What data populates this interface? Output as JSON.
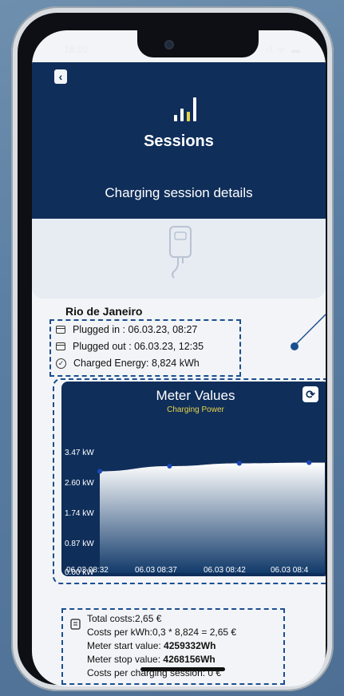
{
  "status_bar": {
    "time": "18:10",
    "icons": "signal wifi battery"
  },
  "header": {
    "title": "Sessions",
    "subtitle": "Charging session details"
  },
  "session": {
    "location": "Rio de Janeiro",
    "plugged_in": "Plugged in : 06.03.23, 08:27",
    "plugged_out": "Plugged out : 06.03.23, 12:35",
    "charged_energy": "Charged Energy: 8,824 kWh"
  },
  "chart_data": {
    "type": "area",
    "title": "Meter Values",
    "subtitle": "Charging Power",
    "y_ticks": [
      "3.47 kW",
      "2.60 kW",
      "1.74 kW",
      "0.87 kW",
      "0.00 kW"
    ],
    "x_ticks": [
      "06.03 08:32",
      "06.03 08:37",
      "06.03 08:42",
      "06.03 08:4"
    ],
    "ylim": [
      0,
      3.47
    ],
    "x": [
      "08:27",
      "08:33",
      "08:42",
      "08:48"
    ],
    "values": [
      2.95,
      3.1,
      3.18,
      3.2
    ],
    "colors": {
      "fill_top": "#ffffff",
      "fill_bottom": "#123a6a",
      "point": "#1c49b8"
    }
  },
  "costs": {
    "total": "Total costs:2,65 €",
    "per_kwh": "Costs per kWh:0,3 * 8,824 = 2,65 €",
    "meter_start_label": "Meter start value: ",
    "meter_start_value": "4259332Wh",
    "meter_stop_label": "Meter stop value: ",
    "meter_stop_value": "4268156Wh",
    "per_session": "Costs per charging session: 0 €"
  },
  "colors": {
    "header": "#0f2e5a",
    "dashed_border": "#1a4f8f",
    "accent": "#e8d34a"
  }
}
